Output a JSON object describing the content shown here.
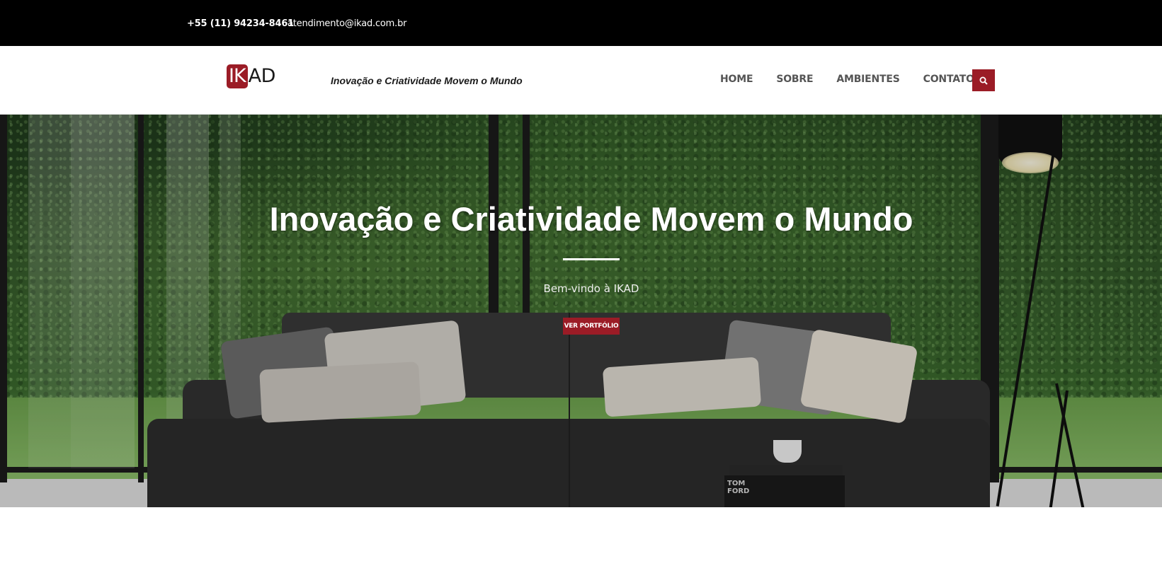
{
  "topbar": {
    "phone": "+55 (11) 94234-8461",
    "email": "atendimento@ikad.com.br"
  },
  "header": {
    "logo_ik": "IK",
    "logo_ad": "AD",
    "tagline": "Inovação e Criatividade Movem o Mundo",
    "nav": [
      "HOME",
      "SOBRE",
      "AMBIENTES",
      "CONTATO"
    ],
    "search_icon": "search-icon"
  },
  "hero": {
    "title": "Inovação e Criatividade Movem o Mundo",
    "subtitle": "Bem-vindo à IKAD",
    "button": "VER PORTFÓLIO",
    "book_text": "TOM FORD"
  },
  "colors": {
    "accent": "#9b1c26",
    "topbar": "#000000",
    "nav_text": "#555555"
  }
}
